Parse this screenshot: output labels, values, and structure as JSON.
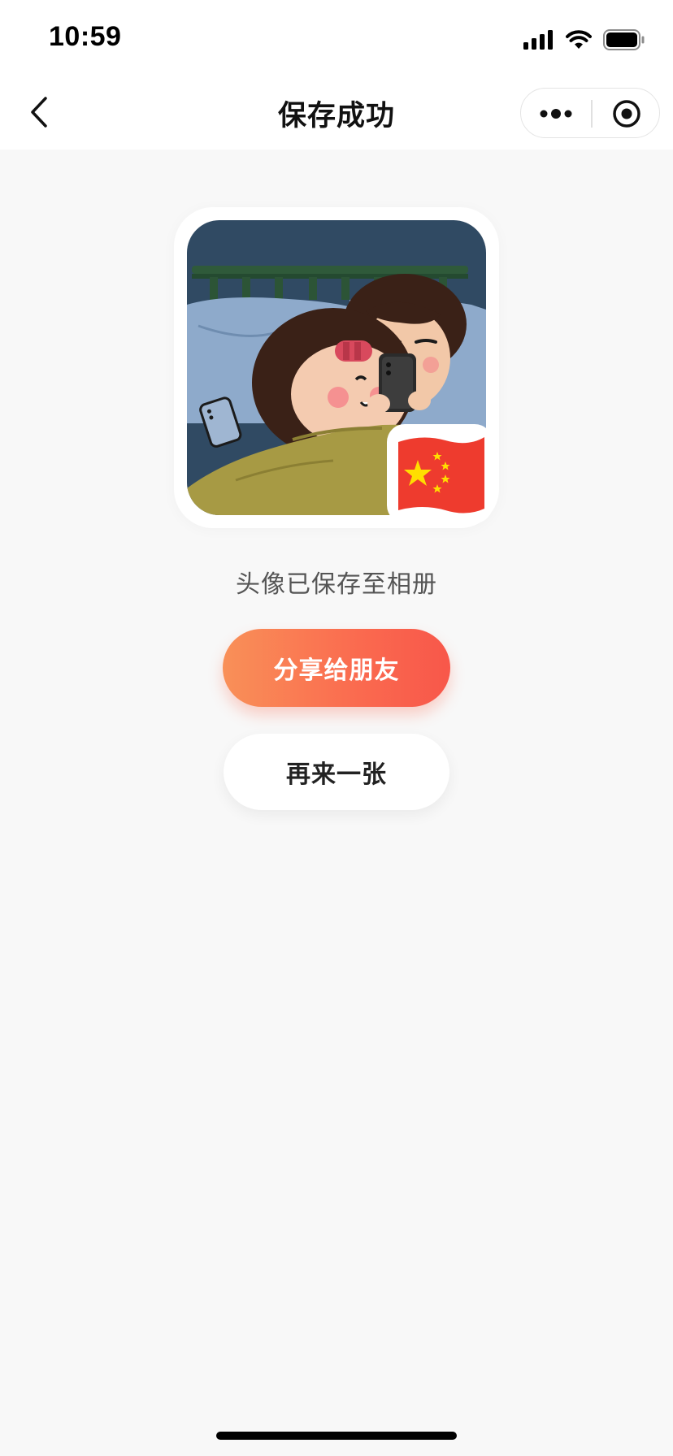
{
  "status_bar": {
    "time": "10:59",
    "icons": [
      "cellular-signal-icon",
      "wifi-icon",
      "battery-icon"
    ]
  },
  "nav": {
    "title": "保存成功",
    "back_icon": "chevron-left-icon",
    "more_icon": "more-dots-icon",
    "close_icon": "target-close-icon"
  },
  "avatar": {
    "description_icon": "avatar-illustration",
    "badge_icon": "china-flag-icon"
  },
  "main": {
    "saved_message": "头像已保存至相册",
    "share_label": "分享给朋友",
    "again_label": "再来一张"
  },
  "colors": {
    "background": "#f8f8f8",
    "accent_start": "#f99058",
    "accent_end": "#f8574a",
    "flag_red": "#ee3b2e",
    "flag_star": "#ffde00"
  }
}
